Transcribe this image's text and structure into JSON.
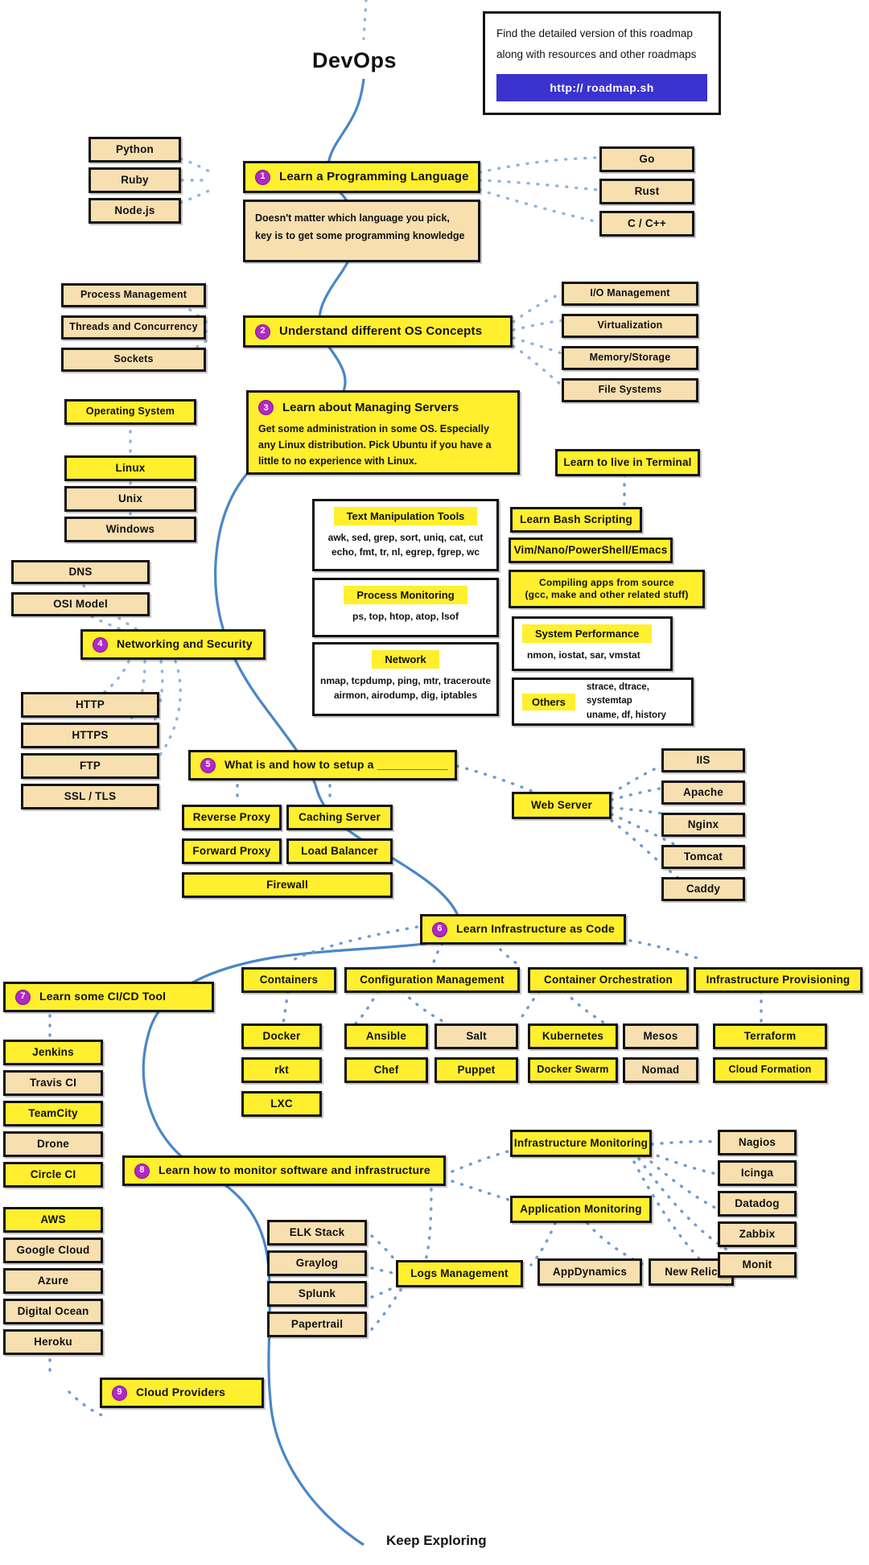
{
  "title": "DevOps",
  "footer": "Keep Exploring",
  "colors": {
    "yellow": "#ffef2e",
    "tan": "#f7dfb0",
    "badge": "#b527c4",
    "wire": "#4a86c8",
    "url_button": "#3b32cf"
  },
  "infobox": {
    "line1": "Find the detailed version of this roadmap",
    "line2": "along with resources and other roadmaps",
    "url": "http:// roadmap.sh"
  },
  "steps": {
    "s1": {
      "num": "1",
      "label": "Learn a Programming Language"
    },
    "s2": {
      "num": "2",
      "label": "Understand different OS Concepts"
    },
    "s3": {
      "num": "3",
      "label": "Learn about Managing Servers",
      "desc": "Get some administration in some OS. Especially any Linux distribution. Pick Ubuntu if you have a little to no experience with Linux."
    },
    "s4": {
      "num": "4",
      "label": "Networking and Security"
    },
    "s5": {
      "num": "5",
      "label": "What is and how to setup a ___________"
    },
    "s6": {
      "num": "6",
      "label": "Learn Infrastructure as Code"
    },
    "s7": {
      "num": "7",
      "label": "Learn some CI/CD Tool"
    },
    "s8": {
      "num": "8",
      "label": "Learn how to monitor software and infrastructure"
    },
    "s9": {
      "num": "9",
      "label": "Cloud Providers"
    }
  },
  "lang_note": "Doesn't matter which language you pick, key is to get some programming knowledge",
  "languages_left": [
    "Python",
    "Ruby",
    "Node.js"
  ],
  "languages_right": [
    "Go",
    "Rust",
    "C / C++"
  ],
  "os_left": [
    "Process Management",
    "Threads and Concurrency",
    "Sockets"
  ],
  "os_right": [
    "I/O Management",
    "Virtualization",
    "Memory/Storage",
    "File Systems"
  ],
  "operating_system": "Operating System",
  "os_list": [
    "Linux",
    "Unix",
    "Windows"
  ],
  "terminal": {
    "header": "Learn to live in Terminal",
    "bash": "Learn Bash Scripting",
    "editors": "Vim/Nano/PowerShell/Emacs",
    "compiling_l1": "Compiling apps from source",
    "compiling_l2": "(gcc, make and other related stuff)"
  },
  "tool_blocks": [
    {
      "band": "Text Manipulation Tools",
      "body": "awk, sed, grep, sort, uniq, cat, cut\nechо, fmt, tr, nl, egrep, fgrep, wc"
    },
    {
      "band": "Process Monitoring",
      "body": "ps, top, htop, atop, lsof"
    },
    {
      "band": "Network",
      "body": "nmap, tcpdump, ping, mtr, traceroute\nairmon, airodump, dig, iptables"
    }
  ],
  "text_manip": {
    "band": "Text Manipulation Tools",
    "l1": "awk, sed, grep, sort, uniq, cat, cut",
    "l2": "echo, fmt, tr, nl, egrep, fgrep, wc"
  },
  "process_monitoring": {
    "band": "Process Monitoring",
    "l1": "ps, top, htop, atop, lsof"
  },
  "network_block": {
    "band": "Network",
    "l1": "nmap, tcpdump, ping, mtr, traceroute",
    "l2": "airmon, airodump, dig, iptables"
  },
  "system_performance": {
    "band": "System Performance",
    "l1": "nmon, iostat, sar, vmstat"
  },
  "others_block": {
    "band": "Others",
    "l1": "strace, dtrace, systemtap",
    "l2": "uname, df, history"
  },
  "networking_above": [
    "DNS",
    "OSI Model"
  ],
  "networking_below": [
    "HTTP",
    "HTTPS",
    "FTP",
    "SSL / TLS"
  ],
  "setup_left": [
    "Reverse Proxy",
    "Forward Proxy"
  ],
  "setup_mid": [
    "Caching Server",
    "Load Balancer"
  ],
  "setup_firewall": "Firewall",
  "web_server": "Web Server",
  "web_servers": [
    "IIS",
    "Apache",
    "Nginx",
    "Tomcat",
    "Caddy"
  ],
  "iac_columns": [
    {
      "header": "Containers",
      "items": [
        [
          "Docker"
        ],
        [
          "rkt"
        ],
        [
          "LXC"
        ]
      ]
    },
    {
      "header": "Configuration Management",
      "items": [
        [
          "Ansible",
          "Salt"
        ],
        [
          "Chef",
          "Puppet"
        ]
      ]
    },
    {
      "header": "Container Orchestration",
      "items": [
        [
          "Kubernetes",
          "Mesos"
        ],
        [
          "Docker Swarm",
          "Nomad"
        ]
      ]
    },
    {
      "header": "Infrastructure Provisioning",
      "items": [
        [
          "Terraform"
        ],
        [
          "Cloud Formation"
        ]
      ]
    }
  ],
  "containers_header": "Containers",
  "containers_items": [
    "Docker",
    "rkt",
    "LXC"
  ],
  "config_mgmt_header": "Configuration Management",
  "config_mgmt_items": [
    "Ansible",
    "Salt",
    "Chef",
    "Puppet"
  ],
  "orchestration_header": "Container Orchestration",
  "orchestration_items": [
    "Kubernetes",
    "Mesos",
    "Docker Swarm",
    "Nomad"
  ],
  "provisioning_header": "Infrastructure Provisioning",
  "provisioning_items": [
    "Terraform",
    "Cloud Formation"
  ],
  "cicd_tools": [
    "Jenkins",
    "Travis CI",
    "TeamCity",
    "Drone",
    "Circle CI"
  ],
  "cloud_providers": [
    "AWS",
    "Google Cloud",
    "Azure",
    "Digital Ocean",
    "Heroku"
  ],
  "monitoring": {
    "infrastructure": "Infrastructure Monitoring",
    "application": "Application Monitoring",
    "logs": "Logs Management"
  },
  "log_tools": [
    "ELK Stack",
    "Graylog",
    "Splunk",
    "Papertrail"
  ],
  "apm_tools": [
    "AppDynamics",
    "New Relic"
  ],
  "infra_tools": [
    "Nagios",
    "Icinga",
    "Datadog",
    "Zabbix",
    "Monit"
  ]
}
